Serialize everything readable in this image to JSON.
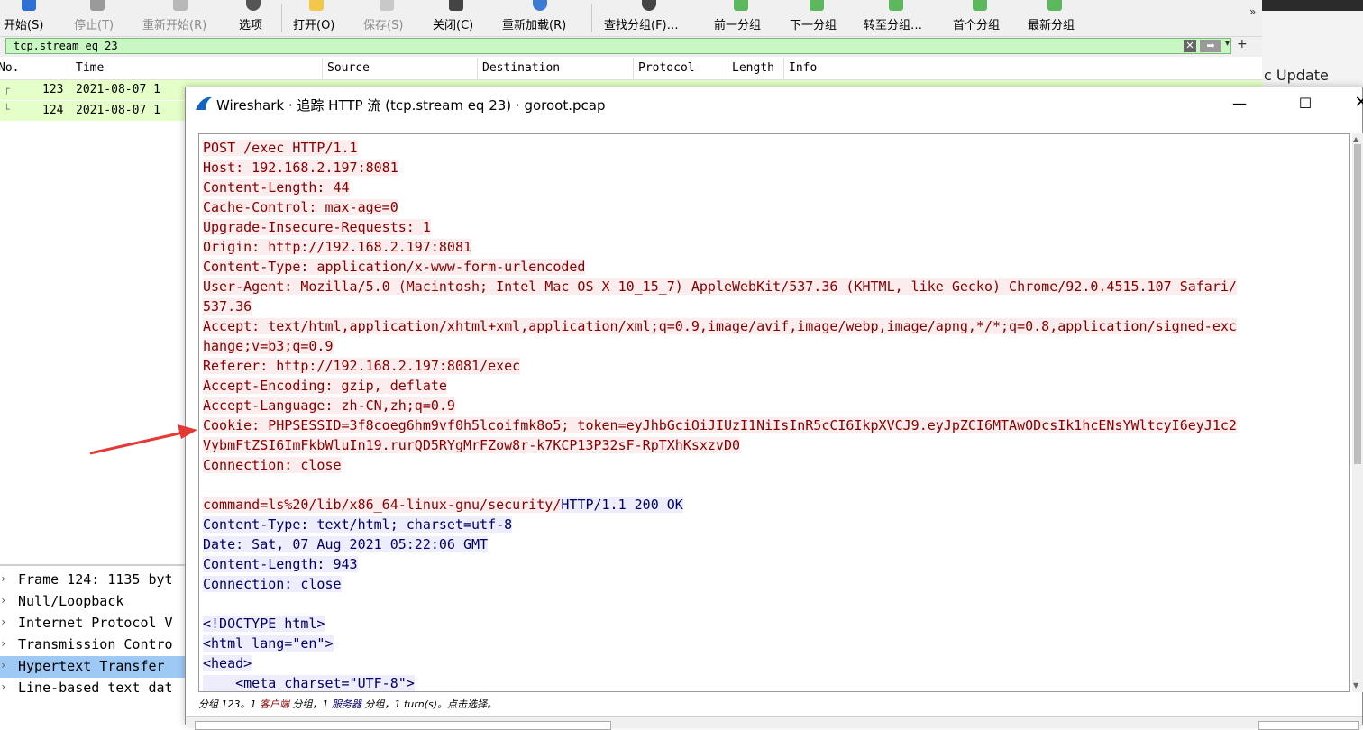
{
  "toolbar": {
    "start": "开始(S)",
    "stop": "停止(T)",
    "restart": "重新开始(R)",
    "options": "选项",
    "open": "打开(O)",
    "save": "保存(S)",
    "close": "关闭(C)",
    "reload": "重新加载(R)",
    "find": "查找分组(F)…",
    "prev": "前一分组",
    "next": "下一分组",
    "goto": "转至分组…",
    "first": "首个分组",
    "last": "最新分组",
    "overflow": "»"
  },
  "filter": {
    "value": "tcp.stream eq 23"
  },
  "packet_list": {
    "columns": {
      "no": "No.",
      "time": "Time",
      "source": "Source",
      "destination": "Destination",
      "protocol": "Protocol",
      "length": "Length",
      "info": "Info"
    },
    "rows": [
      {
        "no": "123",
        "time": "2021-08-07 1"
      },
      {
        "no": "124",
        "time": "2021-08-07 1"
      }
    ]
  },
  "background_right": {
    "text": "c Update"
  },
  "packet_details": [
    "Frame 124: 1135 byt",
    "Null/Loopback",
    "Internet Protocol V",
    "Transmission Contro",
    "Hypertext Transfer",
    "Line-based text dat"
  ],
  "dialog": {
    "title": "Wireshark · 追踪 HTTP 流 (tcp.stream eq 23) · goroot.pcap",
    "status": {
      "prefix": "分组 123。1 ",
      "client": "客户端",
      "mid": " 分组，1 ",
      "server": "服务器",
      "suffix": " 分组，1 turn(s)。点击选择。"
    },
    "lines": [
      {
        "t": "POST /exec HTTP/1.1",
        "c": "cl"
      },
      {
        "t": "Host: 192.168.2.197:8081",
        "c": "cl"
      },
      {
        "t": "Content-Length: 44",
        "c": "cl"
      },
      {
        "t": "Cache-Control: max-age=0",
        "c": "cl"
      },
      {
        "t": "Upgrade-Insecure-Requests: 1",
        "c": "cl"
      },
      {
        "t": "Origin: http://192.168.2.197:8081",
        "c": "cl"
      },
      {
        "t": "Content-Type: application/x-www-form-urlencoded",
        "c": "cl"
      },
      {
        "t": "User-Agent: Mozilla/5.0 (Macintosh; Intel Mac OS X 10_15_7) AppleWebKit/537.36 (KHTML, like Gecko) Chrome/92.0.4515.107 Safari/",
        "c": "cl"
      },
      {
        "t": "537.36",
        "c": "cl"
      },
      {
        "t": "Accept: text/html,application/xhtml+xml,application/xml;q=0.9,image/avif,image/webp,image/apng,*/*;q=0.8,application/signed-exc",
        "c": "cl"
      },
      {
        "t": "hange;v=b3;q=0.9",
        "c": "cl"
      },
      {
        "t": "Referer: http://192.168.2.197:8081/exec",
        "c": "cl"
      },
      {
        "t": "Accept-Encoding: gzip, deflate",
        "c": "cl"
      },
      {
        "t": "Accept-Language: zh-CN,zh;q=0.9",
        "c": "cl"
      },
      {
        "t": "Cookie: PHPSESSID=3f8coeg6hm9vf0h5lcoifmk8o5; token=eyJhbGciOiJIUzI1NiIsInR5cCI6IkpXVCJ9.eyJpZCI6MTAwODcsIk1hcENsYWltcyI6eyJ1c2",
        "c": "cl"
      },
      {
        "t": "VybmFtZSI6ImFkbWluIn19.rurQD5RYgMrFZow8r-k7KCP13P32sF-RpTXhKsxzvD0",
        "c": "cl"
      },
      {
        "t": "Connection: close",
        "c": "cl"
      },
      {
        "t": "",
        "c": ""
      },
      {
        "t": "command=ls%20/lib/x86_64-linux-gnu/security/",
        "c": "cl",
        "tail": "HTTP/1.1 200 OK",
        "tc": "sv"
      },
      {
        "t": "Content-Type: text/html; charset=utf-8",
        "c": "sv"
      },
      {
        "t": "Date: Sat, 07 Aug 2021 05:22:06 GMT",
        "c": "sv"
      },
      {
        "t": "Content-Length: 943",
        "c": "sv"
      },
      {
        "t": "Connection: close",
        "c": "sv"
      },
      {
        "t": "",
        "c": ""
      },
      {
        "t": "<!DOCTYPE html>",
        "c": "sv"
      },
      {
        "t": "<html lang=\"en\">",
        "c": "sv"
      },
      {
        "t": "<head>",
        "c": "sv"
      },
      {
        "t": "    <meta charset=\"UTF-8\">",
        "c": "sv"
      }
    ]
  },
  "colors": {
    "client_text": "#870000",
    "client_bg": "#fbeded",
    "server_text": "#00006b",
    "server_bg": "#ededfb",
    "filter_bg": "#c8f7c3",
    "row_bg": "#e4ffc7",
    "selected": "#9ec9f5",
    "annotation": "#e53935"
  }
}
